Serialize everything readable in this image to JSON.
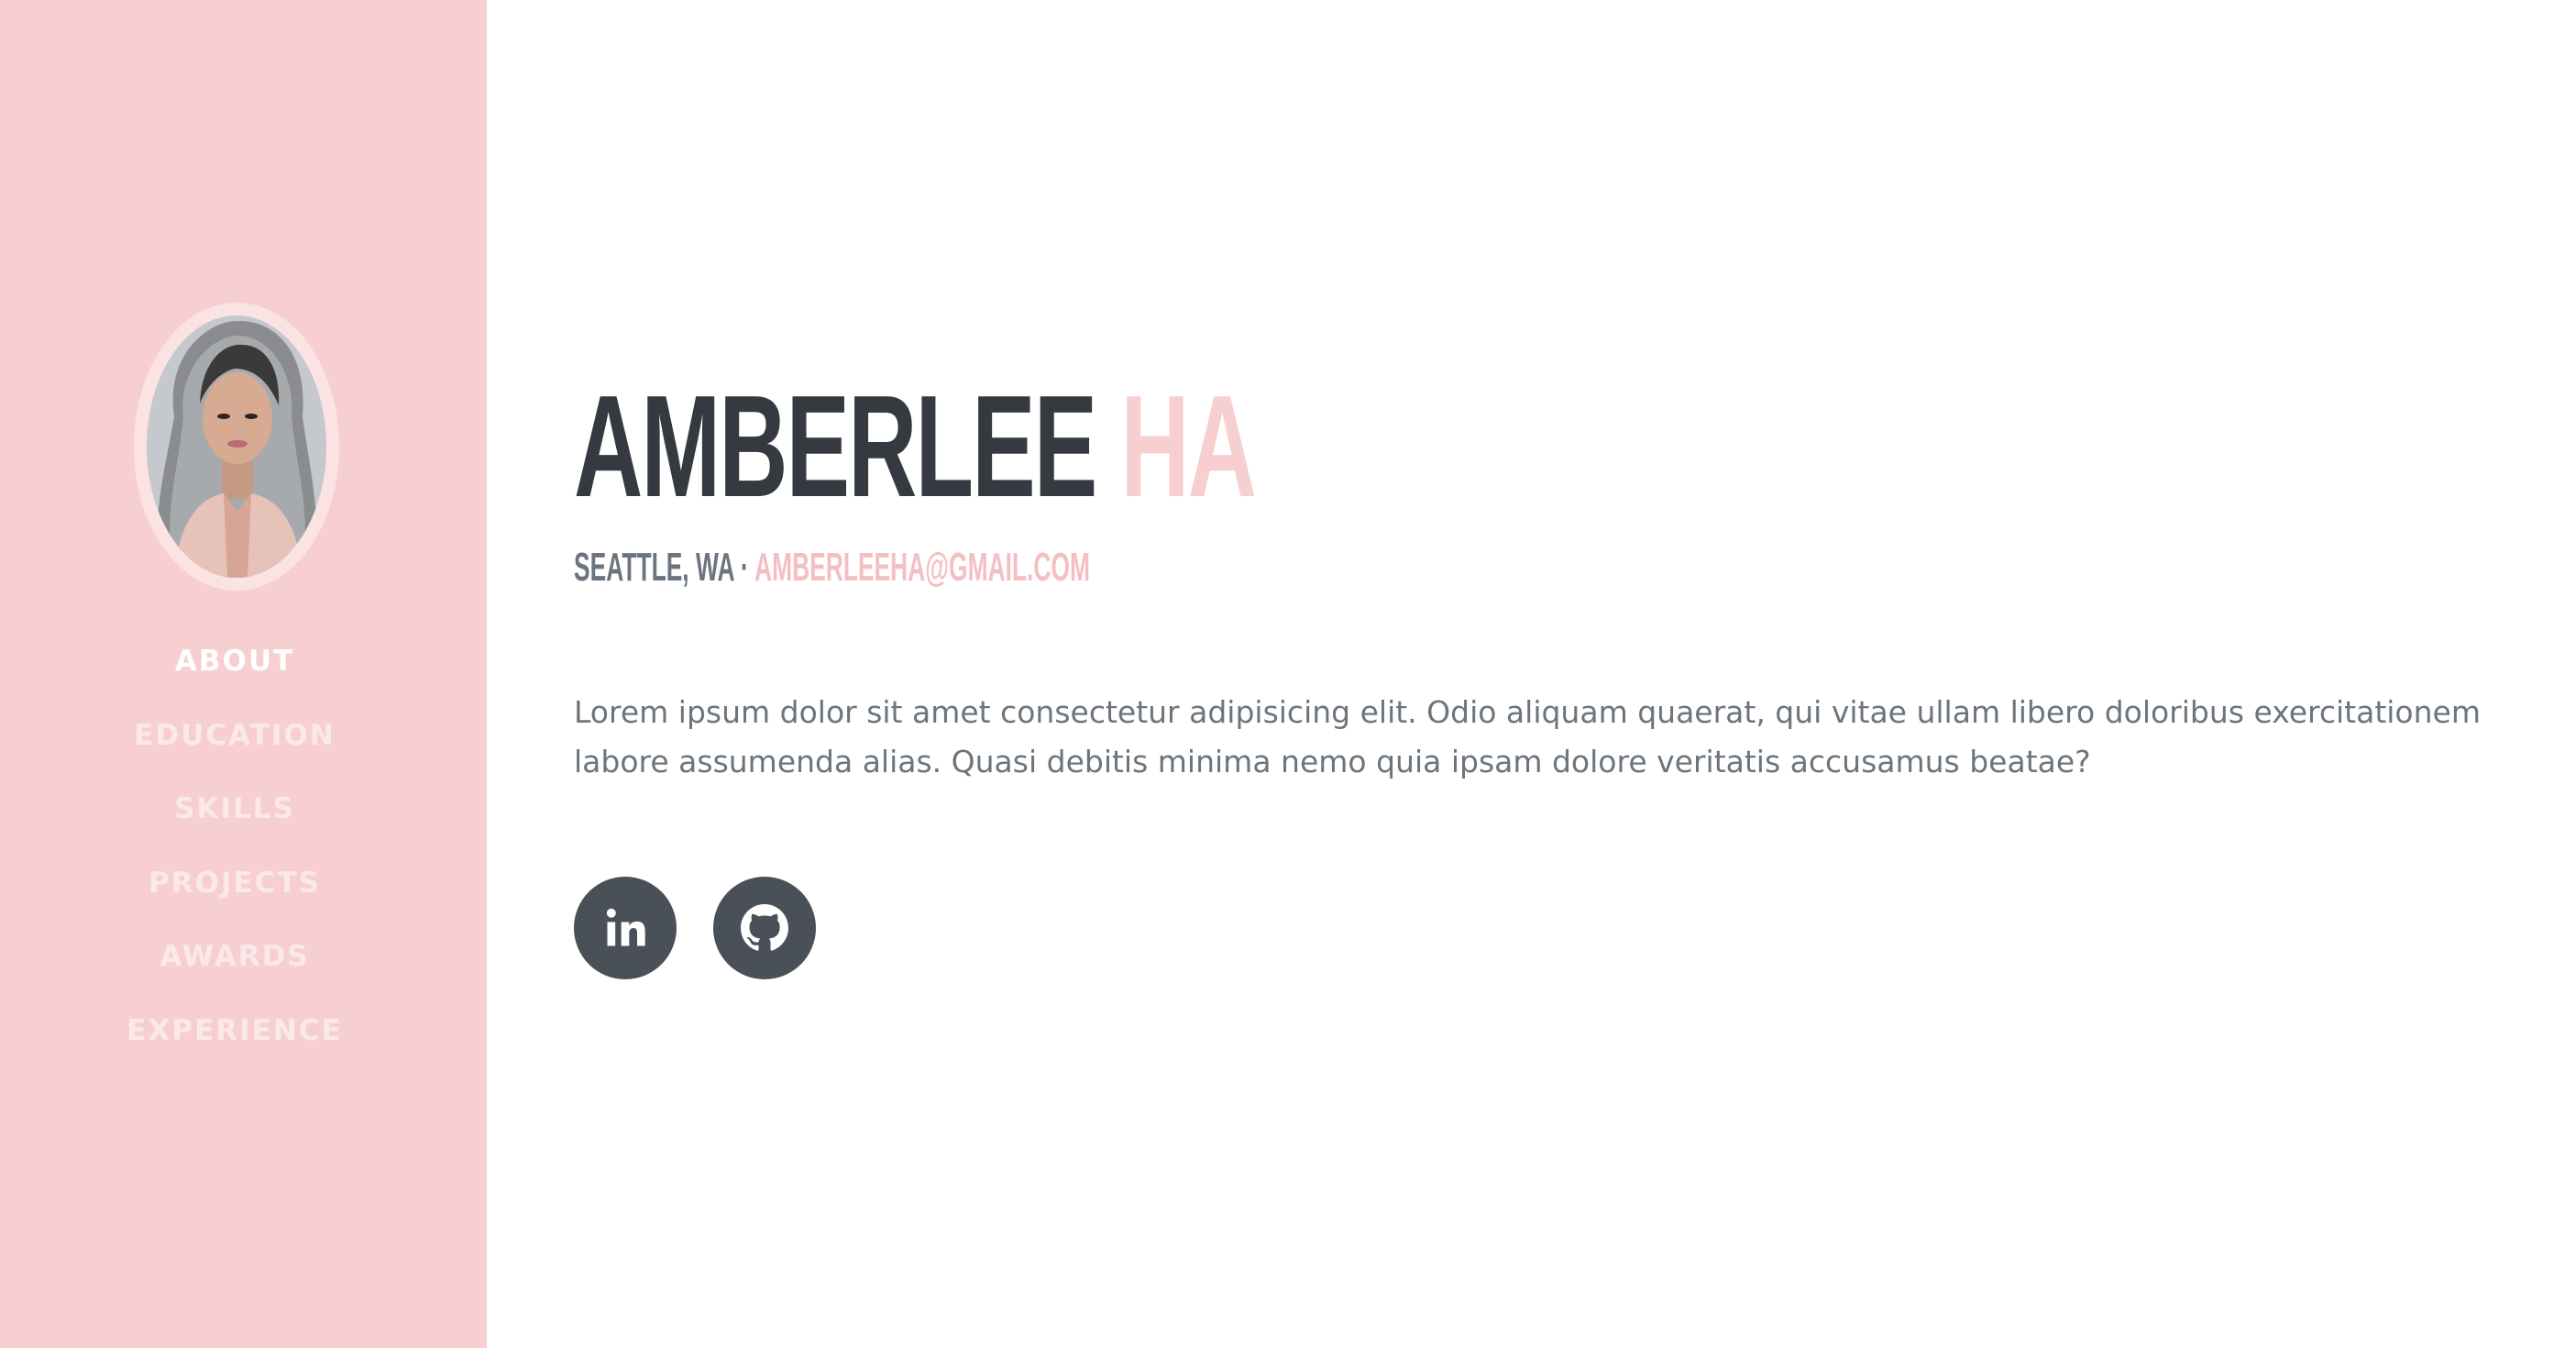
{
  "colors": {
    "primary": "#f7cfd1",
    "heading": "#343a40",
    "muted": "#6c757d",
    "social_bg": "#495057"
  },
  "profile": {
    "photo_alt": "profile photo"
  },
  "nav": {
    "items": [
      {
        "label": "ABOUT",
        "active": true
      },
      {
        "label": "EDUCATION",
        "active": false
      },
      {
        "label": "SKILLS",
        "active": false
      },
      {
        "label": "PROJECTS",
        "active": false
      },
      {
        "label": "AWARDS",
        "active": false
      },
      {
        "label": "EXPERIENCE",
        "active": false
      }
    ]
  },
  "about": {
    "first_name": "AMBERLEE",
    "last_name": "HA",
    "location": "SEATTLE, WA",
    "separator": "·",
    "email": "AMBERLEEHA@GMAIL.COM",
    "lead": "Lorem ipsum dolor sit amet consectetur adipisicing elit. Odio aliquam quaerat, qui vitae ullam libero doloribus exercitationem labore assumenda alias. Quasi debitis minima nemo quia ipsam dolore veritatis accusamus beatae?"
  },
  "social": {
    "linkedin_icon": "linkedin-icon",
    "github_icon": "github-icon"
  }
}
